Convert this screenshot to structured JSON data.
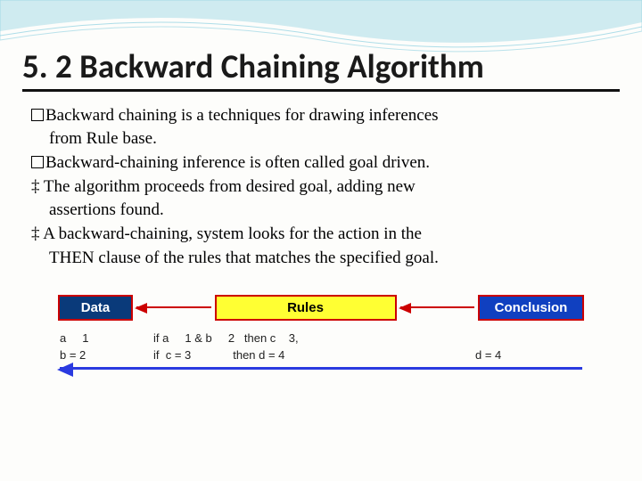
{
  "title": "5. 2 Backward Chaining Algorithm",
  "bullets": {
    "b1": "Backward chaining is a techniques for drawing inferences",
    "b1_cont": "from Rule base.",
    "b2": "Backward-chaining inference is often called goal driven.",
    "b3": "‡ The algorithm proceeds from desired goal, adding new",
    "b3_cont": "assertions found.",
    "b4": "‡ A backward-chaining, system looks for the action in the",
    "b4_cont": "THEN clause of the rules that matches the specified goal."
  },
  "diagram": {
    "data_label": "Data",
    "rules_label": "Rules",
    "conclusion_label": "Conclusion",
    "row1": {
      "c1": "a     1",
      "c2": "if a     1 & b     2   then c    3,",
      "c3": ""
    },
    "row2": {
      "c1": "b = 2",
      "c2": "if  c = 3             then d = 4",
      "c3": "d = 4"
    }
  }
}
